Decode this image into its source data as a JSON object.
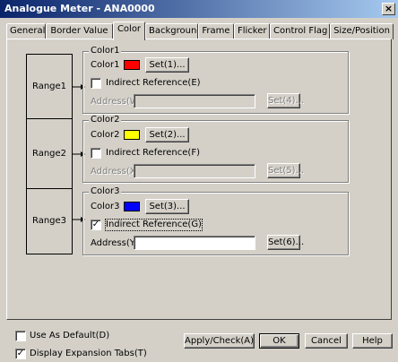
{
  "window": {
    "title": "Analogue Meter - ANA0000",
    "close_glyph": "×"
  },
  "tabs": [
    {
      "label": "General"
    },
    {
      "label": "Border Value"
    },
    {
      "label": "Color",
      "active": true
    },
    {
      "label": "Background"
    },
    {
      "label": "Frame"
    },
    {
      "label": "Flicker"
    },
    {
      "label": "Control Flag"
    },
    {
      "label": "Size/Position"
    }
  ],
  "ranges": [
    {
      "range_label": "Range1",
      "group_title": "Color1",
      "color_label": "Color1",
      "color": "#ff0000",
      "set_button": "Set(1)...",
      "indirect_label": "Indirect Reference(E)",
      "indirect_checked": false,
      "address_label": "Address(W)",
      "address_value": "",
      "address_set_button": "Set(4)...",
      "address_enabled": false
    },
    {
      "range_label": "Range2",
      "group_title": "Color2",
      "color_label": "Color2",
      "color": "#ffff00",
      "set_button": "Set(2)...",
      "indirect_label": "Indirect Reference(F)",
      "indirect_checked": false,
      "address_label": "Address(X)",
      "address_value": "",
      "address_set_button": "Set(5)...",
      "address_enabled": false
    },
    {
      "range_label": "Range3",
      "group_title": "Color3",
      "color_label": "Color3",
      "color": "#0000ff",
      "set_button": "Set(3)...",
      "indirect_label": "Indirect Reference(G)",
      "indirect_checked": true,
      "address_label": "Address(Y)",
      "address_value": "",
      "address_set_button": "Set(6)...",
      "address_enabled": true
    }
  ],
  "footer": {
    "use_as_default": {
      "label": "Use As Default(D)",
      "checked": false
    },
    "display_expansion_tabs": {
      "label": "Display Expansion Tabs(T)",
      "checked": true
    },
    "apply_button": "Apply/Check(A)",
    "ok_button": "OK",
    "cancel_button": "Cancel",
    "help_button": "Help"
  },
  "check_glyph": "✓"
}
